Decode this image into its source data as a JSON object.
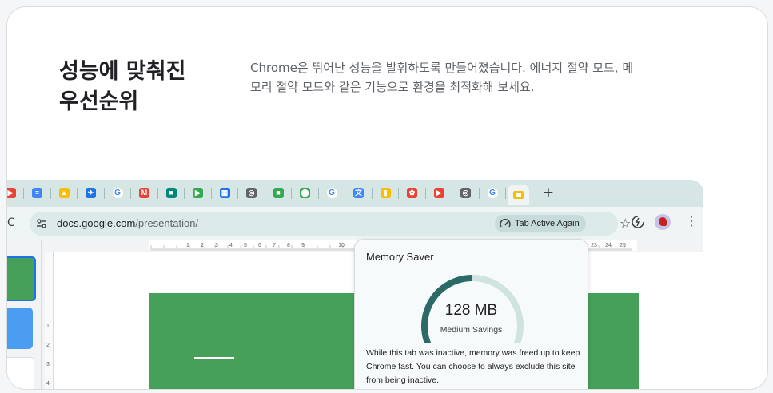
{
  "hero": {
    "headline_line1": "성능에 맞춰진",
    "headline_line2": "우선순위",
    "description": "Chrome은 뛰어난 성능을 발휘하도록 만들어졌습니다. 에너지 절약 모드, 메모리 절약 모드와 같은 기능으로 환경을 최적화해 보세요."
  },
  "browser": {
    "tabs": [
      {
        "icon": "youtube-icon",
        "color": "#ea4335",
        "glyph": "▶"
      },
      {
        "icon": "google-docs-icon",
        "color": "#4285f4",
        "glyph": "≡"
      },
      {
        "icon": "google-drive-icon",
        "color": "#fbbc04",
        "glyph": "▲"
      },
      {
        "icon": "flight-icon",
        "color": "#1a73e8",
        "glyph": "✈"
      },
      {
        "icon": "google-icon",
        "color": "#4285f4",
        "glyph": "G"
      },
      {
        "icon": "gmail-icon",
        "color": "#ea4335",
        "glyph": "M"
      },
      {
        "icon": "google-meet-icon",
        "color": "#00897b",
        "glyph": "■"
      },
      {
        "icon": "google-play-icon",
        "color": "#34a853",
        "glyph": "▶"
      },
      {
        "icon": "google-calendar-icon",
        "color": "#1a73e8",
        "glyph": "▦"
      },
      {
        "icon": "chrome-icon",
        "color": "#5f6368",
        "glyph": "◎"
      },
      {
        "icon": "google-chat-icon",
        "color": "#34a853",
        "glyph": "■"
      },
      {
        "icon": "google-maps-icon",
        "color": "#34a853",
        "glyph": "⬤"
      },
      {
        "icon": "google-icon",
        "color": "#4285f4",
        "glyph": "G"
      },
      {
        "icon": "google-translate-icon",
        "color": "#4285f4",
        "glyph": "文"
      },
      {
        "icon": "google-keep-icon",
        "color": "#fbbc04",
        "glyph": "▮"
      },
      {
        "icon": "google-photos-icon",
        "color": "#ea4335",
        "glyph": "✿"
      },
      {
        "icon": "youtube-music-icon",
        "color": "#ea4335",
        "glyph": "▶"
      },
      {
        "icon": "chrome-icon",
        "color": "#5f6368",
        "glyph": "◎"
      },
      {
        "icon": "google-icon",
        "color": "#4285f4",
        "glyph": "G"
      }
    ],
    "active_tab_icon": "google-slides-icon",
    "active_tab_color": "#fbbc04",
    "new_tab_label": "+",
    "url_host": "docs.google.com",
    "url_path": "/presentation/",
    "tab_status_chip": "Tab Active Again",
    "ruler_ticks": [
      "1",
      "2",
      "3",
      "4",
      "5",
      "6",
      "7",
      "8",
      "9",
      "10",
      "23",
      "24",
      "25"
    ],
    "vertical_ruler_ticks": [
      "1",
      "2",
      "3",
      "4"
    ]
  },
  "memory_saver": {
    "title": "Memory Saver",
    "savings_value": "128 MB",
    "savings_label": "Medium Savings",
    "savings_level": 0.5,
    "body": "While this tab was inactive, memory was freed up to keep Chrome fast. You can choose to always exclude this site from being inactive.",
    "gauge_fill_color": "#2c6a67",
    "gauge_track_color": "#cfe3e1"
  }
}
